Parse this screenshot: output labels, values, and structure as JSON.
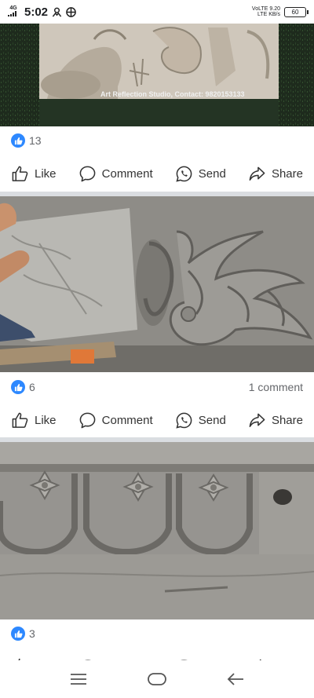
{
  "status_bar": {
    "network_top": "4G",
    "time": "5:02",
    "speed_value": "9.20",
    "speed_unit": "KB/s",
    "volte": "VoLTE",
    "battery": "60"
  },
  "posts": [
    {
      "watermark": "Art Reflection Studio, Contact: 9820153133",
      "reaction_count": "13",
      "comment_count": ""
    },
    {
      "reaction_count": "6",
      "comment_count": "1 comment"
    },
    {
      "reaction_count": "3",
      "comment_count": ""
    }
  ],
  "actions": {
    "like": "Like",
    "comment": "Comment",
    "send": "Send",
    "share": "Share"
  },
  "colors": {
    "like_blue": "#2d88ff",
    "divider": "#dadde1",
    "text_secondary": "#65676b"
  },
  "icons": [
    "profile-icon",
    "vpn-icon",
    "like-badge-icon",
    "thumbs-up-icon",
    "comment-icon",
    "whatsapp-icon",
    "share-icon",
    "menu-icon",
    "home-icon",
    "back-icon"
  ]
}
